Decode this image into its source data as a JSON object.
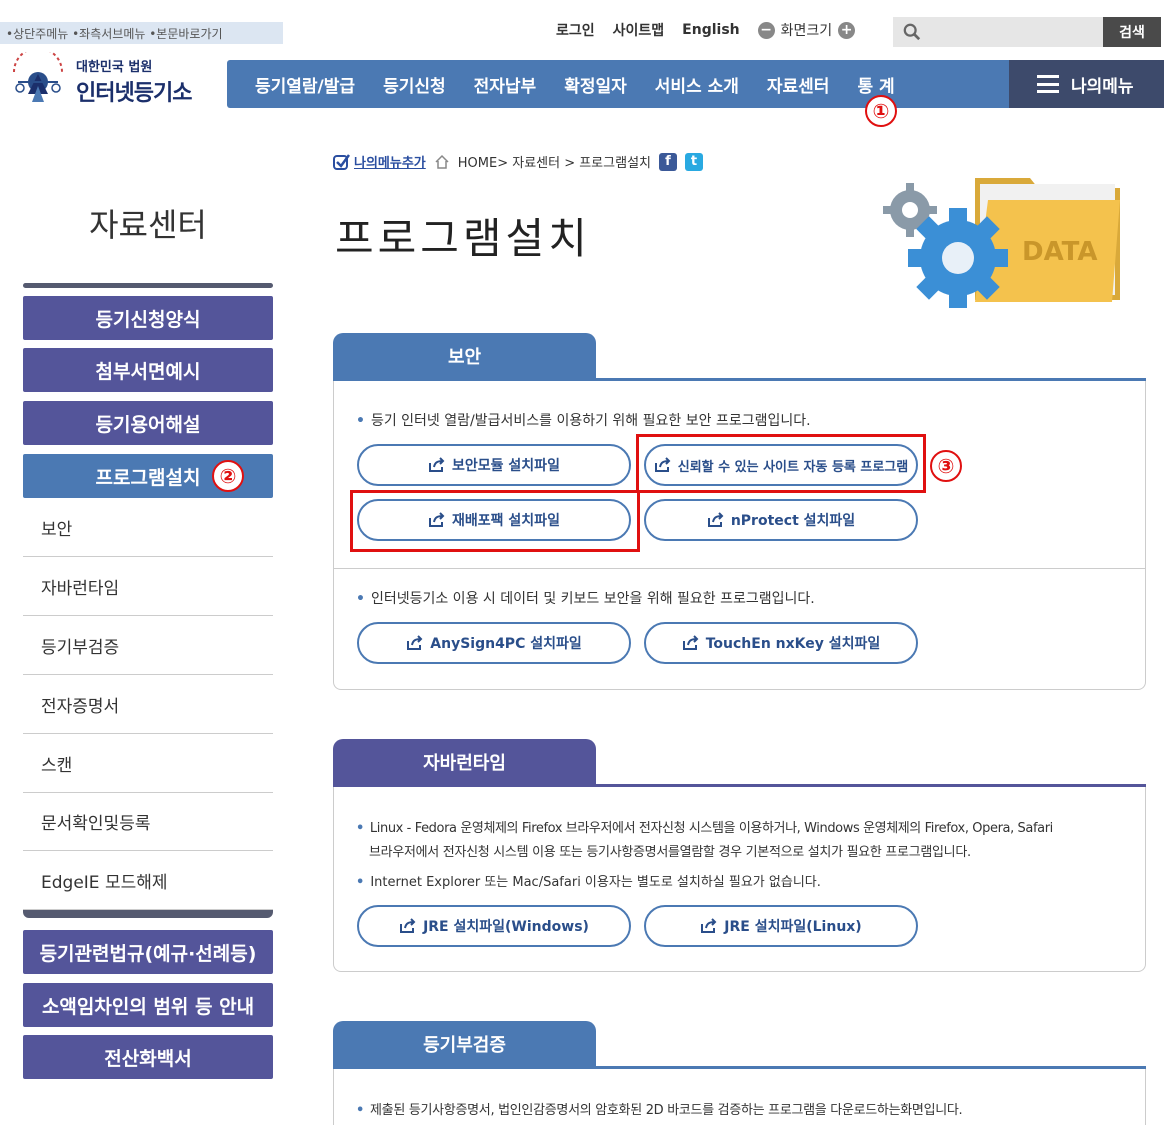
{
  "skip_links": "•상단주메뉴 •좌측서브메뉴 •본문바로가기",
  "util": {
    "login": "로그인",
    "sitemap": "사이트맵",
    "english": "English",
    "zoom": "화면크기",
    "zoom_out": "−",
    "zoom_in": "+"
  },
  "search": {
    "placeholder": "",
    "button": "검색"
  },
  "logo": {
    "top": "대한민국 법원",
    "bottom": "인터넷등기소"
  },
  "gnb": [
    "등기열람/발급",
    "등기신청",
    "전자납부",
    "확정일자",
    "서비스 소개",
    "자료센터",
    "통 계"
  ],
  "mymenu": "나의메뉴",
  "markers": {
    "m1": "①",
    "m2": "②",
    "m3": "③"
  },
  "lnb": {
    "title": "자료센터",
    "buttons": [
      "등기신청양식",
      "첨부서면예시",
      "등기용어해설",
      "프로그램설치"
    ],
    "subs": [
      "보안",
      "자바런타임",
      "등기부검증",
      "전자증명서",
      "스캔",
      "문서확인및등록",
      "EdgeIE 모드해제"
    ],
    "bottom": [
      "등기관련법규(예규·선례등)",
      "소액임차인의 범위 등 안내",
      "전산화백서"
    ]
  },
  "breadcrumb": {
    "add": "나의메뉴추가",
    "path": "HOME> 자료센터 > 프로그램설치",
    "fb": "f",
    "tw": "t"
  },
  "page_title": "프로그램설치",
  "hero_label": "DATA",
  "sections": {
    "security": {
      "tab": "보안",
      "desc1": "등기 인터넷 열람/발급서비스를 이용하기 위해 필요한 보안 프로그램입니다.",
      "btn1": "보안모듈 설치파일",
      "btn2": "신뢰할 수 있는 사이트 자동 등록 프로그램",
      "btn3": "재배포팩 설치파일",
      "btn4": "nProtect 설치파일",
      "desc2": "인터넷등기소 이용 시 데이터 및 키보드 보안을 위해 필요한 프로그램입니다.",
      "btn5": "AnySign4PC 설치파일",
      "btn6": "TouchEn nxKey 설치파일"
    },
    "java": {
      "tab": "자바런타임",
      "desc1": "Linux - Fedora 운영체제의 Firefox 브라우저에서 전자신청 시스템을 이용하거나, Windows 운영체제의 Firefox, Opera, Safari",
      "desc1b": "브라우저에서 전자신청 시스템 이용 또는 등기사항증명서를열람할 경우 기본적으로 설치가 필요한 프로그램입니다.",
      "desc2": "Internet Explorer 또는 Mac/Safari 이용자는 별도로 설치하실 필요가 없습니다.",
      "btn1": "JRE 설치파일(Windows)",
      "btn2": "JRE 설치파일(Linux)"
    },
    "verify": {
      "tab": "등기부검증",
      "desc1": "제출된 등기사항증명서, 법인인감증명서의 암호화된 2D 바코드를 검증하는 프로그램을 다운로드하는화면입니다."
    }
  },
  "colors": {
    "primary": "#4b79b3",
    "purple": "#54559a",
    "marker": "#e01010"
  }
}
